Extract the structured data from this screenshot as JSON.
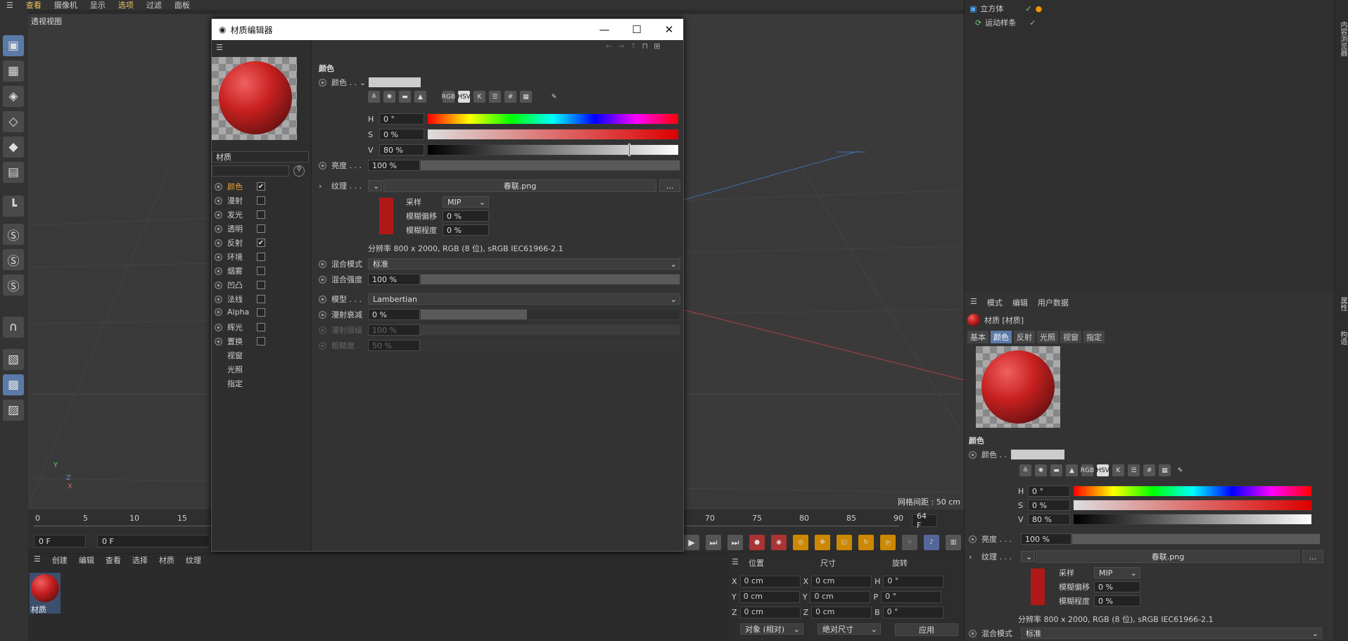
{
  "menubar": {
    "items": [
      "查看",
      "摄像机",
      "显示",
      "选项",
      "过滤",
      "面板"
    ],
    "active": "选项"
  },
  "viewport": {
    "label": "透视视图",
    "grid_spacing": "网格间距 : 50 cm",
    "axis_y": "Y",
    "axis_z": "Z",
    "axis_x": "X"
  },
  "timeline": {
    "ticks": [
      "0",
      "5",
      "10",
      "15",
      "70",
      "75",
      "80",
      "85",
      "90"
    ],
    "start": "0 F",
    "current": "0 F",
    "end": "64 F"
  },
  "bottom_menu": [
    "创建",
    "编辑",
    "查看",
    "选择",
    "材质",
    "纹理"
  ],
  "material_thumb": {
    "label": "材质"
  },
  "coords": {
    "headers": [
      "位置",
      "尺寸",
      "旋转"
    ],
    "rows": [
      {
        "a": "X",
        "pos": "0 cm",
        "b": "X",
        "size": "0 cm",
        "c": "H",
        "rot": "0 °"
      },
      {
        "a": "Y",
        "pos": "0 cm",
        "b": "Y",
        "size": "0 cm",
        "c": "P",
        "rot": "0 °"
      },
      {
        "a": "Z",
        "pos": "0 cm",
        "b": "Z",
        "size": "0 cm",
        "c": "B",
        "rot": "0 °"
      }
    ],
    "mode": "对象 (相对)",
    "size_mode": "绝对尺寸",
    "apply": "应用"
  },
  "objects": [
    {
      "name": "立方体"
    },
    {
      "name": "运动样条"
    }
  ],
  "attr": {
    "menu": [
      "模式",
      "编辑",
      "用户数据"
    ],
    "title": "材质 [材质]",
    "tabs": [
      "基本",
      "颜色",
      "反射",
      "光照",
      "视窗",
      "指定"
    ],
    "active_tab": "颜色",
    "section": "颜色",
    "color_label": "颜色 . .",
    "h": "0 °",
    "s": "0 %",
    "v": "80 %",
    "brightness_label": "亮度 . . .",
    "brightness": "100 %",
    "texture_label": "纹理 . . .",
    "texture_file": "春联.png",
    "sampling_label": "采样",
    "sampling": "MIP",
    "blur_offset_label": "模糊偏移",
    "blur_offset": "0 %",
    "blur_degree_label": "模糊程度",
    "blur_degree": "0 %",
    "resolution": "分辨率 800 x 2000, RGB (8 位), sRGB IEC61966-2.1",
    "blend_label": "混合模式",
    "blend": "标准",
    "icons": [
      "RGB",
      "HSV",
      "K",
      "#"
    ]
  },
  "strip": [
    "内容浏览器",
    "属性",
    "构造"
  ],
  "dialog": {
    "title": "材质编辑器",
    "name": "材质",
    "channels": [
      {
        "label": "颜色",
        "checked": "✔",
        "active": true
      },
      {
        "label": "漫射",
        "checked": ""
      },
      {
        "label": "发光",
        "checked": ""
      },
      {
        "label": "透明",
        "checked": ""
      },
      {
        "label": "反射",
        "checked": "✔"
      },
      {
        "label": "环境",
        "checked": ""
      },
      {
        "label": "烟雾",
        "checked": ""
      },
      {
        "label": "凹凸",
        "checked": ""
      },
      {
        "label": "法线",
        "checked": ""
      },
      {
        "label": "Alpha",
        "checked": ""
      },
      {
        "label": "辉光",
        "checked": ""
      },
      {
        "label": "置换",
        "checked": ""
      }
    ],
    "extra": [
      "视窗",
      "光照",
      "指定"
    ],
    "section": "颜色",
    "color_label": "颜色 . .",
    "icons": [
      "RGB",
      "HSV",
      "K",
      "#"
    ],
    "h_label": "H",
    "h": "0 °",
    "s_label": "S",
    "s": "0 %",
    "v_label": "V",
    "v": "80 %",
    "v_level": 0.8,
    "brightness_label": "亮度 . . .",
    "brightness": "100 %",
    "texture_label": "纹理 . . .",
    "texture_file": "春联.png",
    "more": "...",
    "sampling_label": "采样",
    "sampling": "MIP",
    "blur_offset_label": "模糊偏移",
    "blur_offset": "0 %",
    "blur_degree_label": "模糊程度",
    "blur_degree": "0 %",
    "resolution": "分辨率 800 x 2000, RGB (8 位), sRGB IEC61966-2.1",
    "blend_label": "混合模式",
    "blend": "标准",
    "blend_strength_label": "混合强度",
    "blend_strength": "100 %",
    "model_label": "模型 . . .",
    "model": "Lambertian",
    "diffuse_falloff_label": "漫射衰减",
    "diffuse_falloff": "0 %",
    "diffuse_level_label": "漫射层级",
    "diffuse_level": "100 %",
    "roughness_label": "粗糙度 .",
    "roughness": "50 %"
  }
}
